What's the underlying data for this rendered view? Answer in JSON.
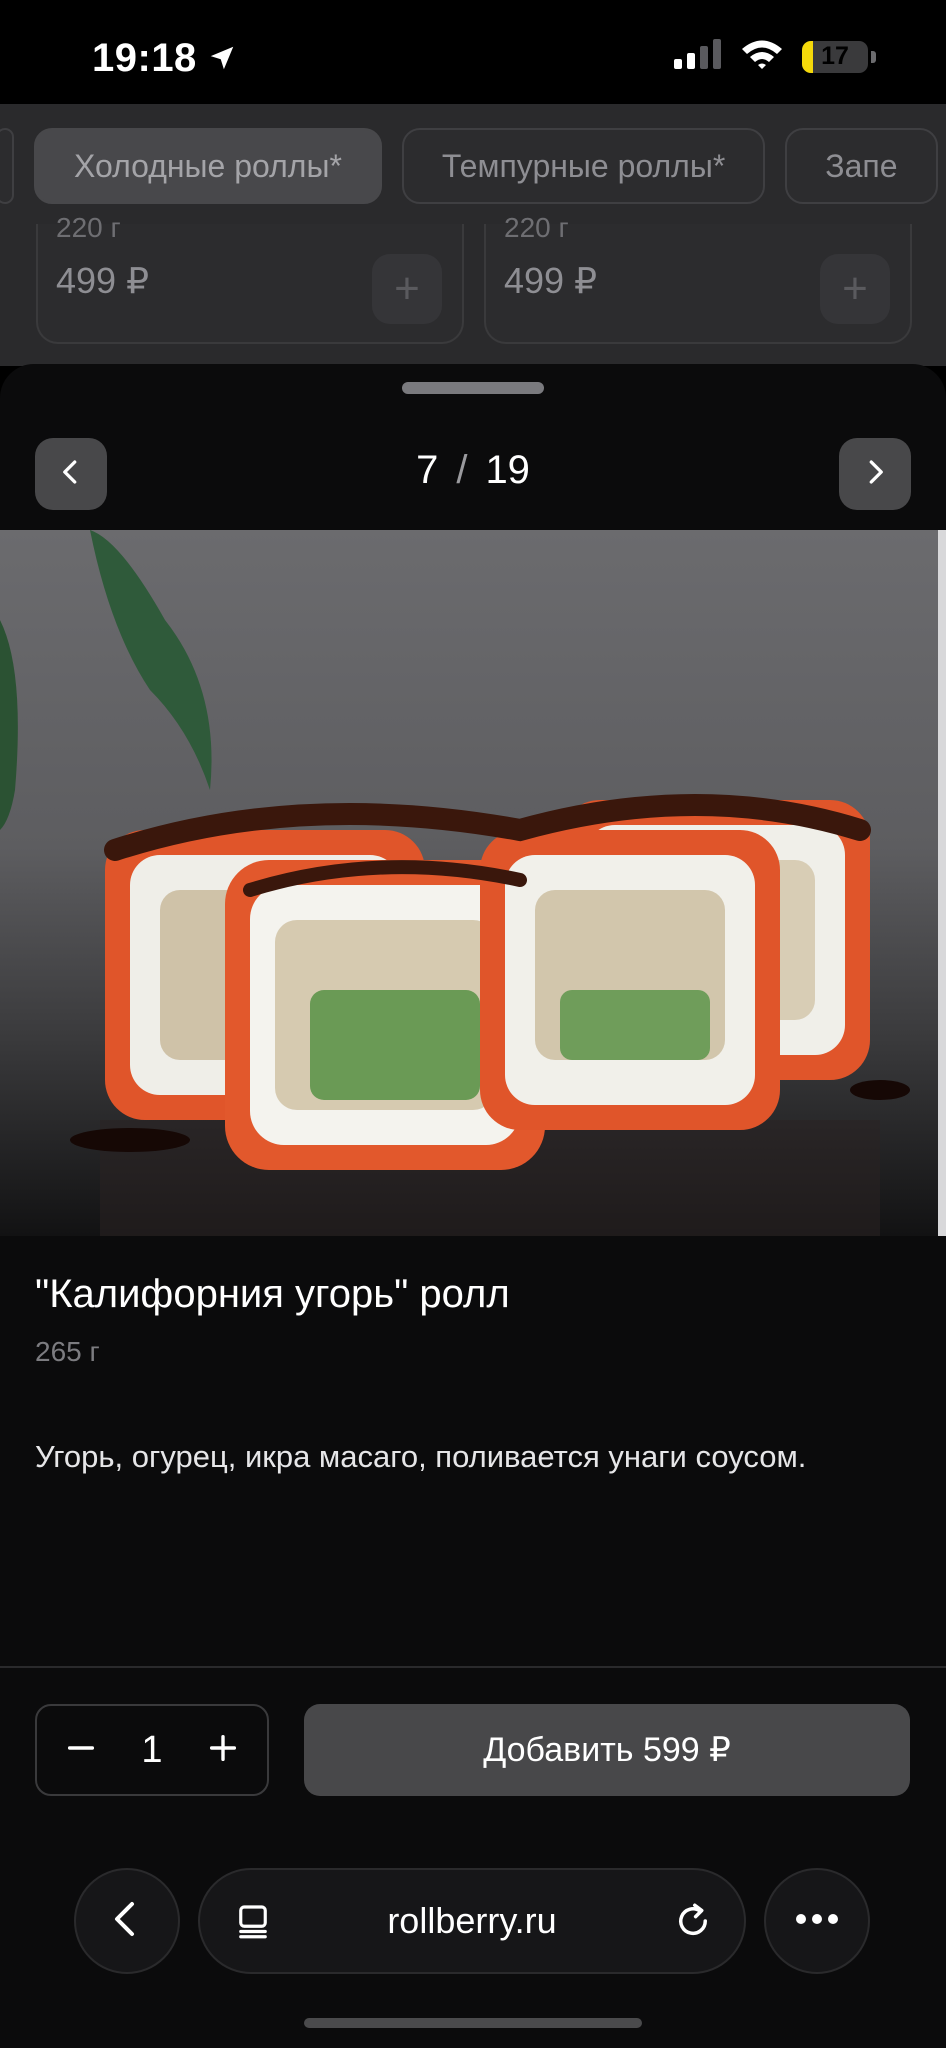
{
  "status_bar": {
    "time": "19:18",
    "battery": "17",
    "battery_level": 0.17
  },
  "background_page": {
    "categories": [
      {
        "label": "Холодные роллы*",
        "active": true
      },
      {
        "label": "Темпурные роллы*",
        "active": false
      },
      {
        "label": "Запе",
        "active": false
      }
    ],
    "cards": [
      {
        "cut_text": "220 г",
        "price": "499 ₽"
      },
      {
        "cut_text": "220 г",
        "price": "499 ₽"
      }
    ]
  },
  "sheet": {
    "pager": {
      "current": "7",
      "separator": "/",
      "total": "19"
    },
    "product": {
      "title": "\"Калифорния угорь\" ролл",
      "weight": "265 г",
      "description": "Угорь, огурец, икра масаго, поливается унаги соусом."
    },
    "quantity": "1",
    "add_button": "Добавить 599 ₽"
  },
  "browser": {
    "url": "rollberry.ru"
  },
  "icons": {
    "location": "location-arrow-icon",
    "signal": "signal-icon",
    "wifi": "wifi-icon",
    "prev": "chevron-left-icon",
    "next": "chevron-right-icon",
    "minus": "minus-icon",
    "plus": "plus-icon",
    "back": "back-icon",
    "tabs": "tabs-icon",
    "reload": "reload-icon",
    "more": "more-icon"
  }
}
